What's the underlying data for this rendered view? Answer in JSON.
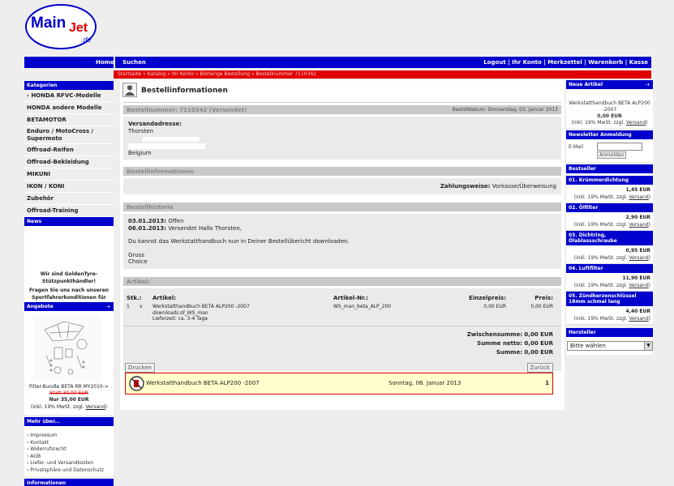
{
  "logo": {
    "main": "Main",
    "jet": "Jet",
    "de": ".de"
  },
  "nav": {
    "home": "Home",
    "search": "Suchen",
    "logout": "Logout",
    "account": "Ihr Konto",
    "wishlist": "Merkzettel",
    "cart": "Warenkorb",
    "checkout": "Kasse",
    "sep": "|"
  },
  "breadcrumb": "Startseite » Katalog » Ihr Konto » Bisherige Bestellung » Bestellnummer 7110342",
  "left": {
    "categories_title": "Kategorien",
    "categories": [
      "› HONDA RFVC-Modelle",
      "HONDA andere Modelle",
      "BETAMOTOR",
      "Enduro / MotoCross / Supermoto",
      "Offroad-Reifen",
      "Offroad-Bekleidung",
      "MIKUNI",
      "IKON / KONI",
      "Zubehör",
      "Offroad-Training"
    ],
    "news_title": "News",
    "news_line1": "Wir sind GoldenTyre-Stützpunkthändler!",
    "news_line2": "Fragen Sie uns nach unseren Sportfahrerkonditionen für Reifen!",
    "offers_title": "Angebote",
    "offer_name": "Filter-Bundle BETA RR MY2010->",
    "offer_old": "Statt 30,00 EUR",
    "offer_new": "Nur 35,00 EUR",
    "offer_note_pre": "(inkl. 19% MwSt. zzgl. ",
    "offer_note_link": "Versand",
    "offer_note_post": ")",
    "more_title": "Mehr über...",
    "more_items": [
      "› Impressum",
      "› Kontakt",
      "› Widerrufsrecht",
      "› AGB",
      "› Liefer- und Versandkosten",
      "› Privatsphäre und Datenschutz"
    ],
    "info_title": "Informationen"
  },
  "main": {
    "title": "Bestellinformationen",
    "order_no": "Bestellnummer: 7110342 (Versendet)",
    "order_date": "Bestelldatum: Donnerstag, 03. Januar 2013",
    "ship_label": "Versandadresse:",
    "ship_name": "Thorsten",
    "ship_country": "Belgium",
    "info_head": "Bestellinformationen",
    "pay_label": "Zahlungsweise:",
    "pay_value": "Vorkasse/Überweisung",
    "hist_head": "Bestellhistorie",
    "hist1_date": "03.01.2013:",
    "hist1_text": "Offen",
    "hist2_date": "06.01.2013:",
    "hist2_text": "Versendet Hallo Thorsten,",
    "hist_msg": "Du kannst das Werkstatthandbuch nun in Deiner Bestellübericht downloaden.",
    "hist_greet1": "Gruss",
    "hist_greet2": "Choice",
    "art_head": "Artikel:",
    "col_qty": "Stk.:",
    "col_art": "Artikel:",
    "col_no": "Artikel-Nr.:",
    "col_unit": "Einzelpreis:",
    "col_price": "Preis:",
    "row_qty": "1",
    "row_x": "x",
    "row_name": "Werkstatthandbuch BETA ALP200 -2007",
    "row_dl": "downloads:dl_WS_man",
    "row_delivery": "Lieferzeit: ca. 3-4 Tage",
    "row_no": "WS_man_beta_ALP_200",
    "row_unit": "0,00 EUR",
    "row_price": "0,00 EUR",
    "subtotal": "Zwischensumme: 0,00 EUR",
    "net": "Summe netto: 0,00 EUR",
    "total": "Summe: 0,00 EUR",
    "print": "Drucken",
    "back": "Zurück",
    "dl_name": "Werkstatthandbuch BETA ALP200 -2007",
    "dl_date": "Sonntag, 06. Januar 2013",
    "dl_count": "1"
  },
  "right": {
    "new_title": "Neue Artikel",
    "new_name": "Werkstatthandbuch BETA ALP200 -2007",
    "new_price": "0,00 EUR",
    "vat_pre": "(inkl. 19% MwSt. zzgl. ",
    "vat_link": "Versand",
    "vat_post": ")",
    "newsletter_title": "Newsletter Anmeldung",
    "email_label": "E-Mail",
    "subscribe": "Anmelden",
    "best_title": "Bestseller",
    "bestsellers": [
      {
        "name": "01. Krümmerdichtung",
        "price": "1,45 EUR"
      },
      {
        "name": "02. Ölfilter",
        "price": "2,90 EUR"
      },
      {
        "name": "03. Dichtring, Ölablassschraube",
        "price": "0,95 EUR"
      },
      {
        "name": "04. Luftfilter",
        "price": "11,90 EUR"
      },
      {
        "name": "05. Zündkerzenschlüssel 18mm schmal lang",
        "price": "4,40 EUR"
      }
    ],
    "maker_title": "Hersteller",
    "maker_select": "Bitte wählen"
  }
}
